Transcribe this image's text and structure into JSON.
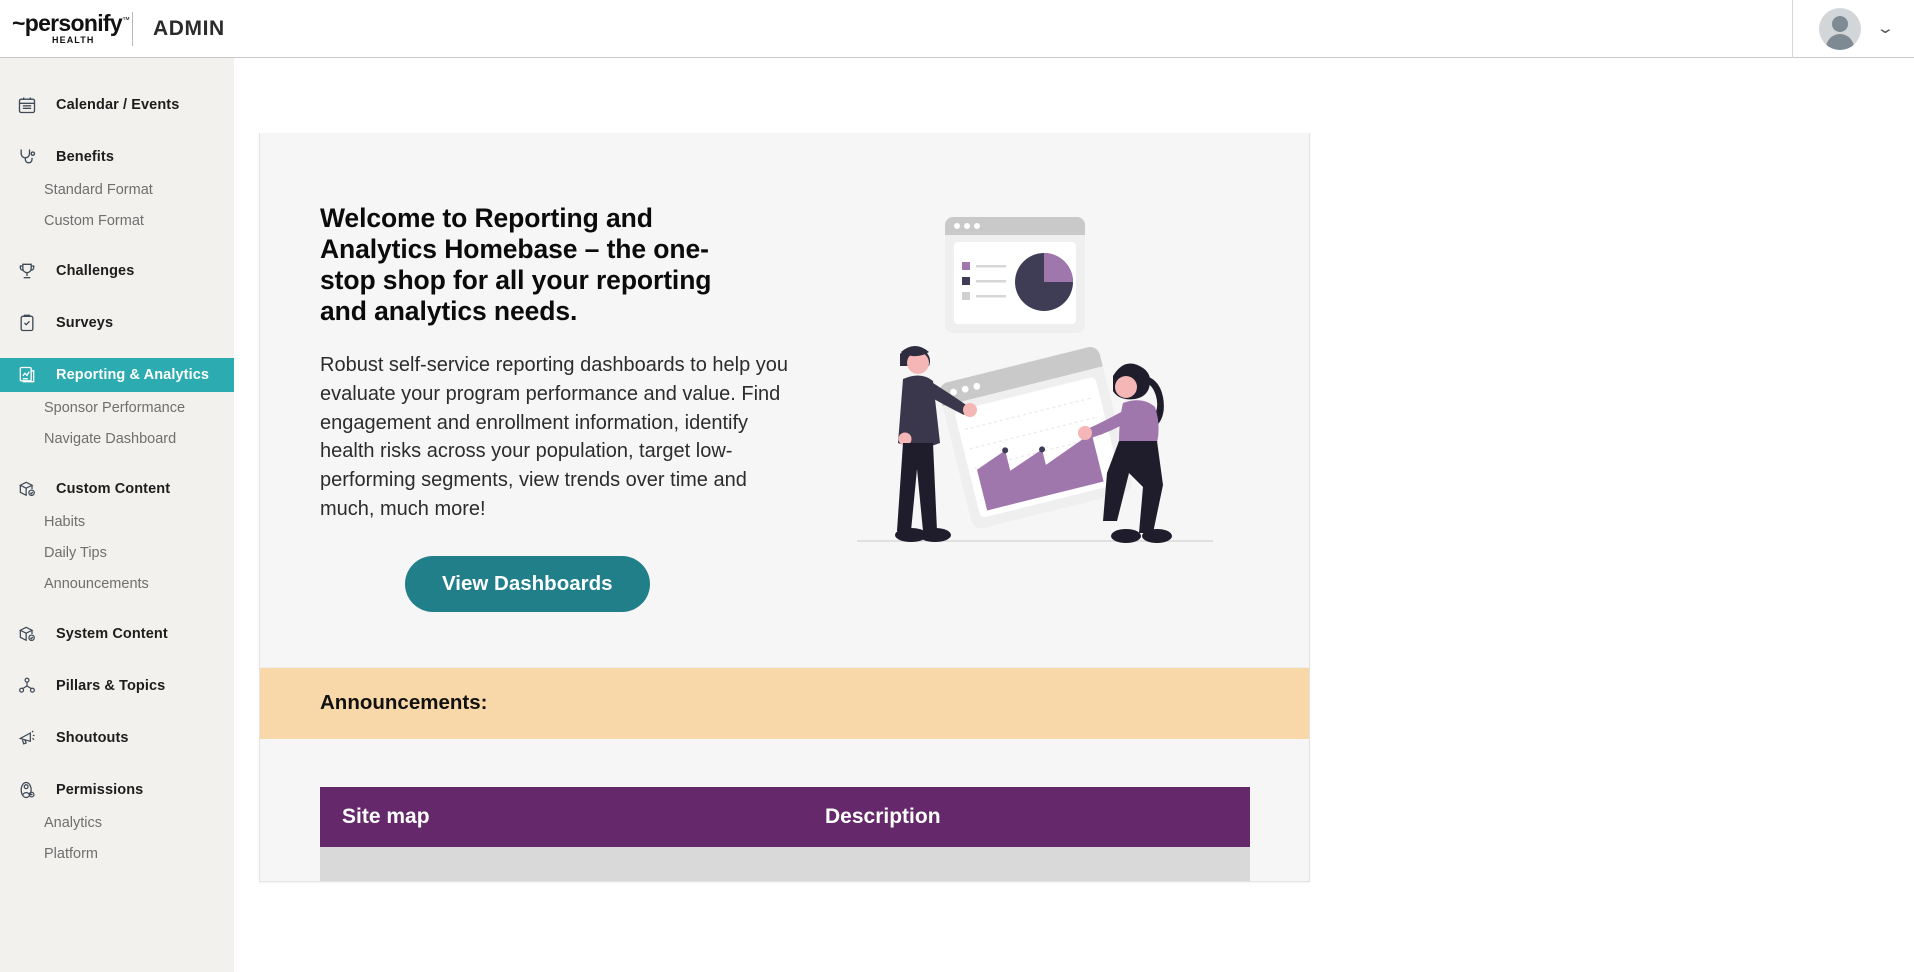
{
  "header": {
    "logo_main": "~personify",
    "logo_sub": "HEALTH",
    "logo_tm": "™",
    "admin_label": "ADMIN",
    "avatar_icon": "user-avatar-icon",
    "chevron_icon": "chevron-down-icon"
  },
  "sidebar": {
    "items": [
      {
        "label": "Calendar / Events",
        "icon": "calendar-icon",
        "type": "parent",
        "active": false
      },
      {
        "label": "Benefits",
        "icon": "stethoscope-icon",
        "type": "parent",
        "active": false
      },
      {
        "label": "Standard Format",
        "type": "child"
      },
      {
        "label": "Custom Format",
        "type": "child"
      },
      {
        "label": "Challenges",
        "icon": "trophy-icon",
        "type": "parent",
        "active": false
      },
      {
        "label": "Surveys",
        "icon": "clipboard-check-icon",
        "type": "parent",
        "active": false
      },
      {
        "label": "Reporting & Analytics",
        "icon": "report-chart-icon",
        "type": "parent",
        "active": true
      },
      {
        "label": "Sponsor Performance",
        "type": "child"
      },
      {
        "label": "Navigate Dashboard",
        "type": "child"
      },
      {
        "label": "Custom Content",
        "icon": "box-check-icon",
        "type": "parent",
        "active": false
      },
      {
        "label": "Habits",
        "type": "child"
      },
      {
        "label": "Daily Tips",
        "type": "child"
      },
      {
        "label": "Announcements",
        "type": "child"
      },
      {
        "label": "System Content",
        "icon": "box-check-icon",
        "type": "parent",
        "active": false
      },
      {
        "label": "Pillars & Topics",
        "icon": "hierarchy-icon",
        "type": "parent",
        "active": false
      },
      {
        "label": "Shoutouts",
        "icon": "megaphone-icon",
        "type": "parent",
        "active": false
      },
      {
        "label": "Permissions",
        "icon": "user-lock-icon",
        "type": "parent",
        "active": false
      },
      {
        "label": "Analytics",
        "type": "child"
      },
      {
        "label": "Platform",
        "type": "child"
      }
    ]
  },
  "hero": {
    "title": "Welcome to Reporting and Analytics Homebase – the one-stop shop for all your reporting and analytics needs.",
    "body": "Robust self-service reporting dashboards to help you evaluate your program performance and value. Find engagement and enrollment information, identify health risks across your population, target low-performing segments, view trends over time and much, much more!",
    "cta_label": "View Dashboards",
    "illustration_name": "people-with-dashboard-illustration"
  },
  "announcements": {
    "title": "Announcements:"
  },
  "sitemap_table": {
    "columns": [
      "Site map",
      "Description"
    ],
    "rows": [
      [
        "",
        ""
      ]
    ]
  },
  "colors": {
    "accent_teal": "#2cabb0",
    "cta_teal": "#217f8a",
    "banner_orange": "#f8d7a8",
    "table_purple": "#65286a",
    "sidebar_bg": "#f2f1ee",
    "card_bg": "#f6f6f6",
    "illustration_purple": "#a077ad",
    "illustration_dark": "#3f3d56"
  }
}
